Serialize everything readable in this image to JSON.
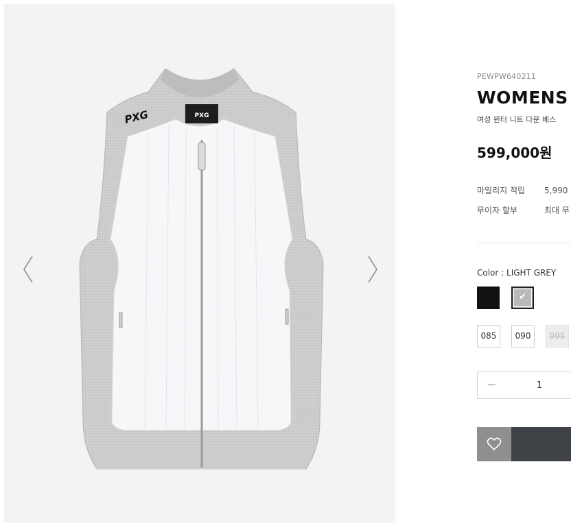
{
  "gallery": {
    "prev_icon": "chevron-left-icon",
    "next_icon": "chevron-right-icon",
    "product_logo": "PXG"
  },
  "product": {
    "sku": "PEWPW640211",
    "title": "WOMENS",
    "subtitle": "여성 윈터 니트 다운 베스",
    "price": "599,000원"
  },
  "benefits": [
    {
      "label": "마일리지 적립",
      "value": "5,990"
    },
    {
      "label": "무이자 할부",
      "value": "최대 무"
    }
  ],
  "options": {
    "color_label": "Color : LIGHT GREY",
    "colors": [
      {
        "name": "black",
        "hex": "#111111",
        "selected": false
      },
      {
        "name": "light-grey",
        "hex": "#b9b9b9",
        "selected": true
      }
    ],
    "check_icon": "✔",
    "sizes": [
      {
        "label": "085",
        "available": true
      },
      {
        "label": "090",
        "available": true
      },
      {
        "label": "095",
        "available": false
      }
    ]
  },
  "quantity": {
    "value": "1"
  },
  "actions": {
    "wishlist_icon": "heart-icon"
  }
}
